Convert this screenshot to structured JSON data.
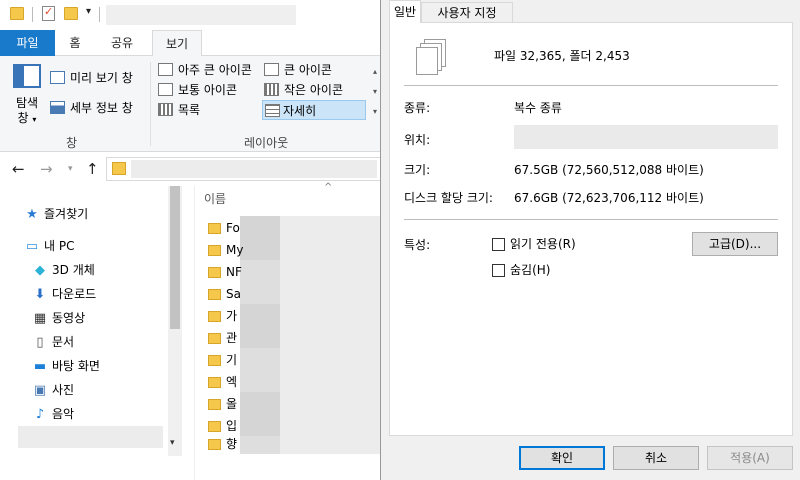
{
  "explorer": {
    "ribbon_tabs": [
      "파일",
      "홈",
      "공유",
      "보기"
    ],
    "panes": {
      "nav_pane_label_line1": "탐색",
      "nav_pane_label_line2": "창",
      "preview_pane": "미리 보기 창",
      "details_pane": "세부 정보 창",
      "group_label": "창"
    },
    "layout": {
      "extra_large_icons": "아주 큰 아이콘",
      "large_icons": "큰 아이콘",
      "medium_icons": "보통 아이콘",
      "small_icons": "작은 아이콘",
      "list": "목록",
      "details": "자세히",
      "group_label": "레이아웃"
    },
    "nav_tree": {
      "quick_access": "즐겨찾기",
      "this_pc": "내 PC",
      "objects_3d": "3D 개체",
      "downloads": "다운로드",
      "videos": "동영상",
      "documents": "문서",
      "desktop": "바탕 화면",
      "pictures": "사진",
      "music": "음악"
    },
    "file_list": {
      "column_name": "이름",
      "rows": [
        "Fo",
        "My",
        "NF",
        "Sa",
        "가",
        "관",
        "기",
        "엑",
        "올",
        "입",
        "향"
      ]
    }
  },
  "dialog": {
    "tabs": [
      "일반",
      "사용자 지정"
    ],
    "summary": "파일 32,365, 폴더 2,453",
    "type_label": "종류:",
    "type_value": "복수 종류",
    "location_label": "위치:",
    "size_label": "크기:",
    "size_value": "67.5GB (72,560,512,088 바이트)",
    "disk_size_label": "디스크 할당 크기:",
    "disk_size_value": "67.6GB (72,623,706,112 바이트)",
    "attributes_label": "특성:",
    "readonly_label": "읽기 전용(R)",
    "hidden_label": "숨김(H)",
    "advanced_button": "고급(D)...",
    "ok_button": "확인",
    "cancel_button": "취소",
    "apply_button": "적용(A)"
  },
  "colors": {
    "file_tab": "#1979ca",
    "folder": "#f5c84b",
    "default_button_border": "#0078d7"
  }
}
